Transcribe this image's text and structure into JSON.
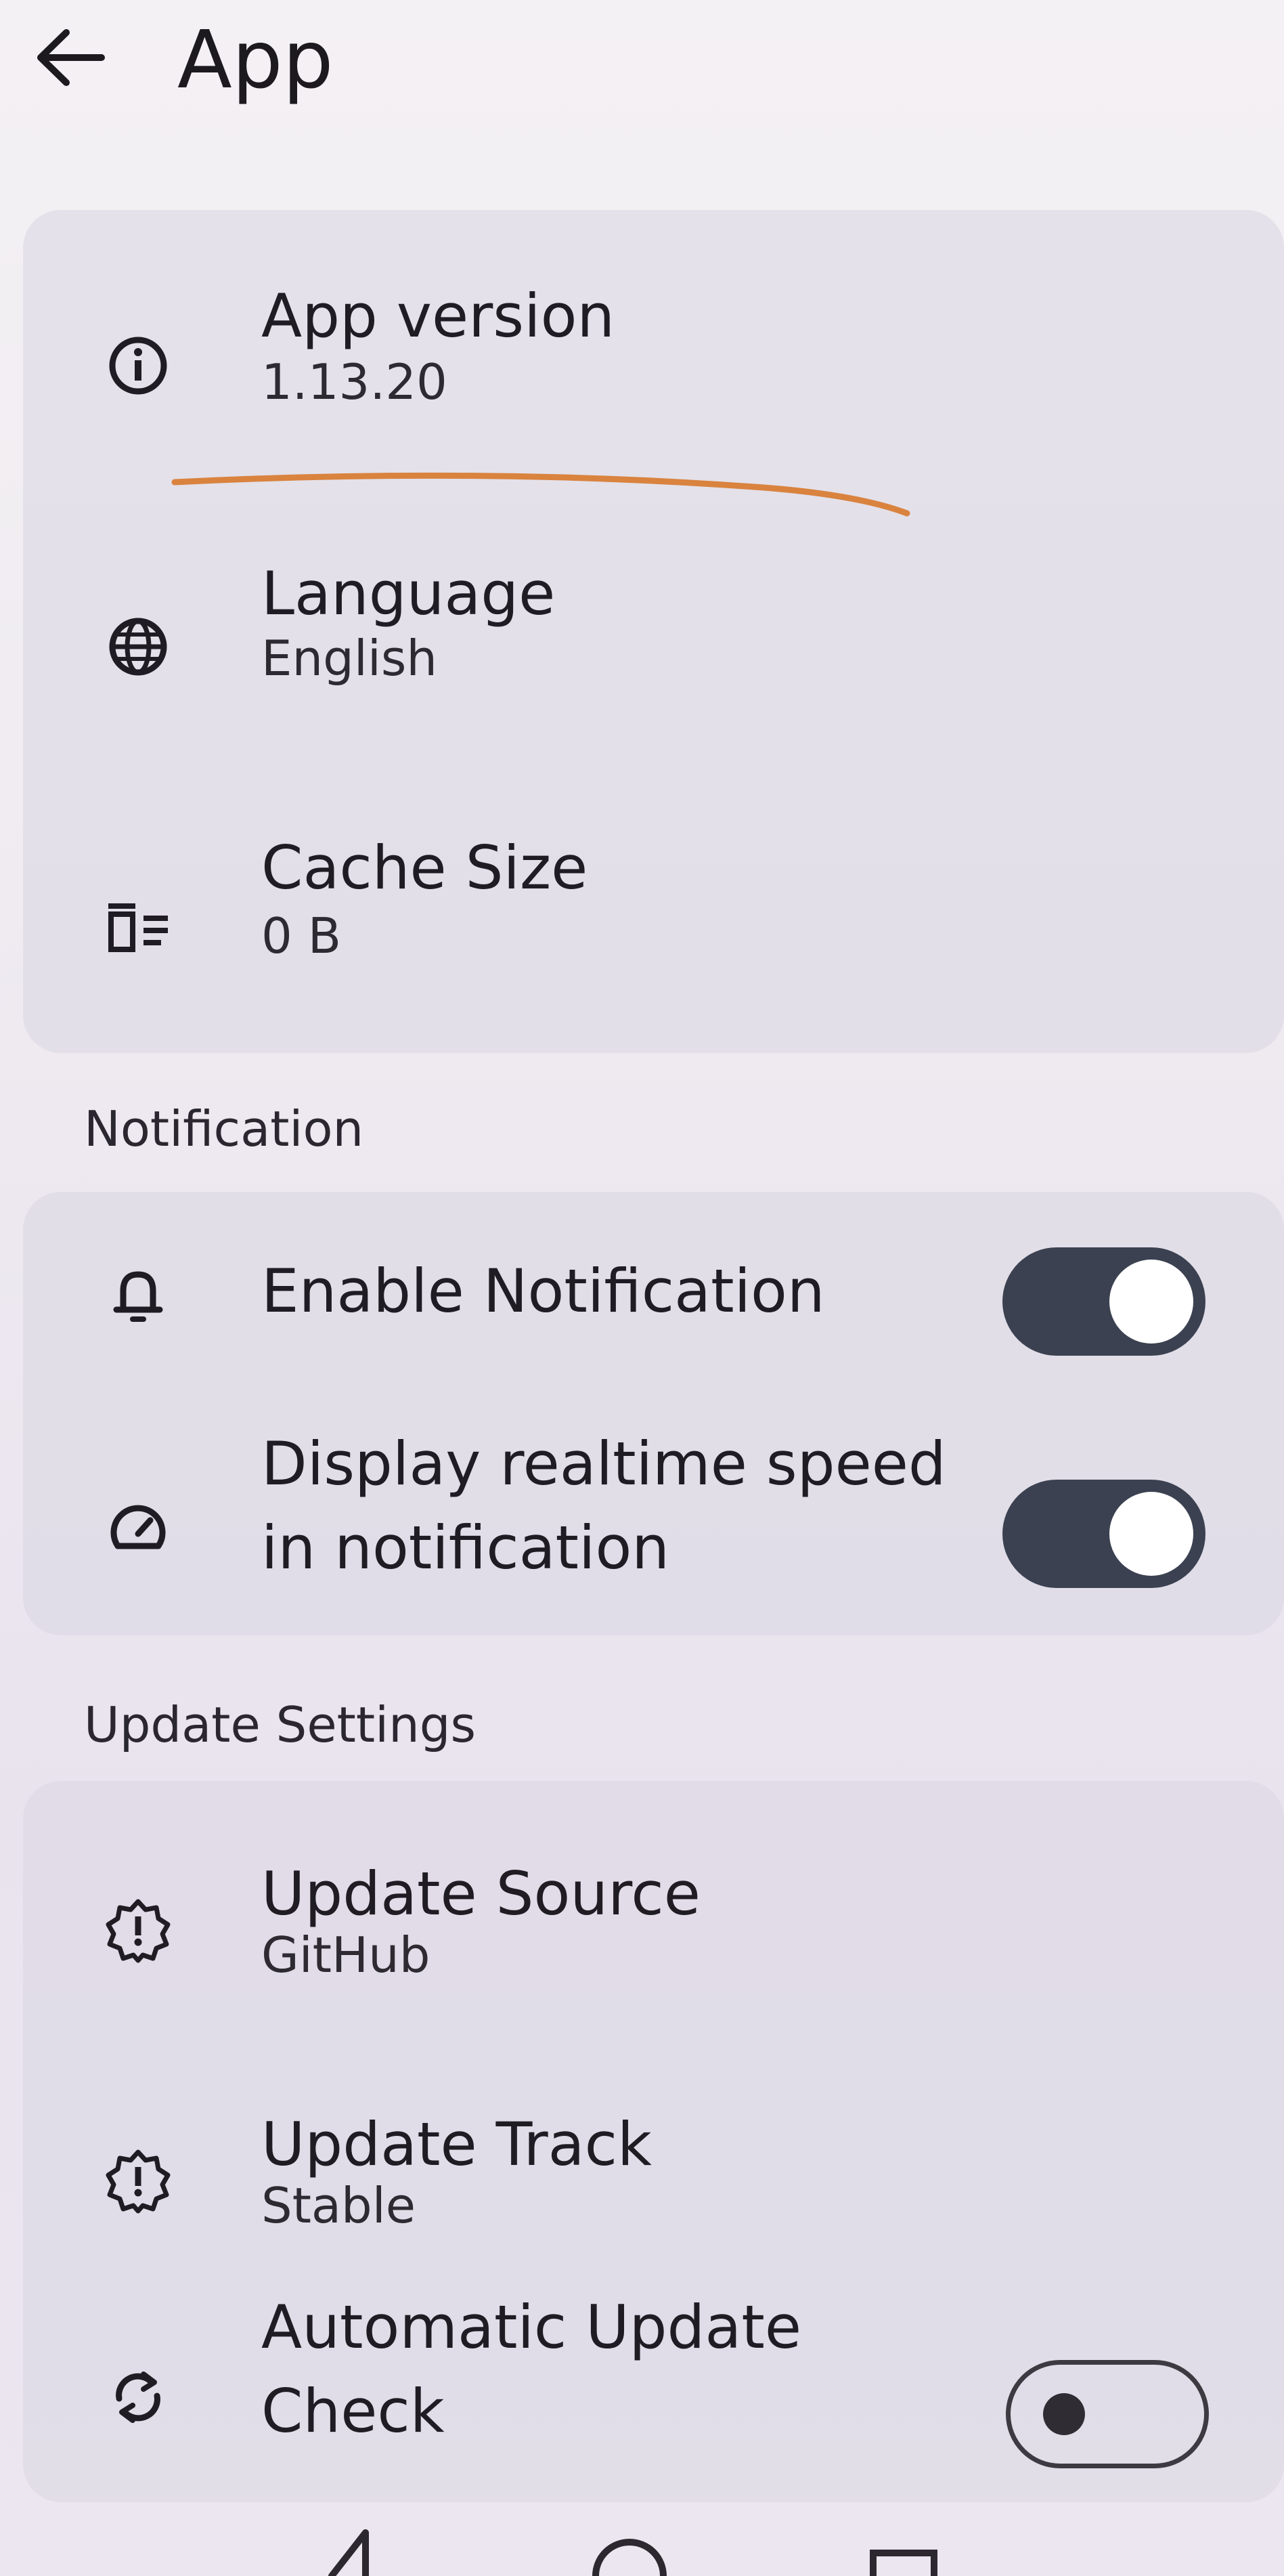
{
  "header": {
    "title": "App",
    "back_icon": "arrow-left-icon"
  },
  "general": {
    "items": [
      {
        "title": "App version",
        "value": "1.13.20",
        "icon": "info-icon"
      },
      {
        "title": "Language",
        "value": "English",
        "icon": "globe-icon"
      },
      {
        "title": "Cache Size",
        "value": "0 B",
        "icon": "cache-clear-icon"
      }
    ]
  },
  "notification": {
    "section_label": "Notification",
    "items": [
      {
        "title": "Enable Notification",
        "icon": "bell-icon",
        "toggle_on": true
      },
      {
        "title": "Display realtime speed in notification",
        "icon": "speedometer-icon",
        "toggle_on": true
      }
    ]
  },
  "update": {
    "section_label": "Update Settings",
    "items": [
      {
        "title": "Update Source",
        "value": "GitHub",
        "icon": "badge-alert-icon"
      },
      {
        "title": "Update Track",
        "value": "Stable",
        "icon": "badge-alert-icon"
      },
      {
        "title": "Automatic Update Check",
        "icon": "sync-icon",
        "toggle_on": false
      }
    ]
  },
  "colors": {
    "toggle_on_track": "#3b4150",
    "card_background": "#dcd8e4",
    "annotation_stroke": "#d9833f"
  }
}
